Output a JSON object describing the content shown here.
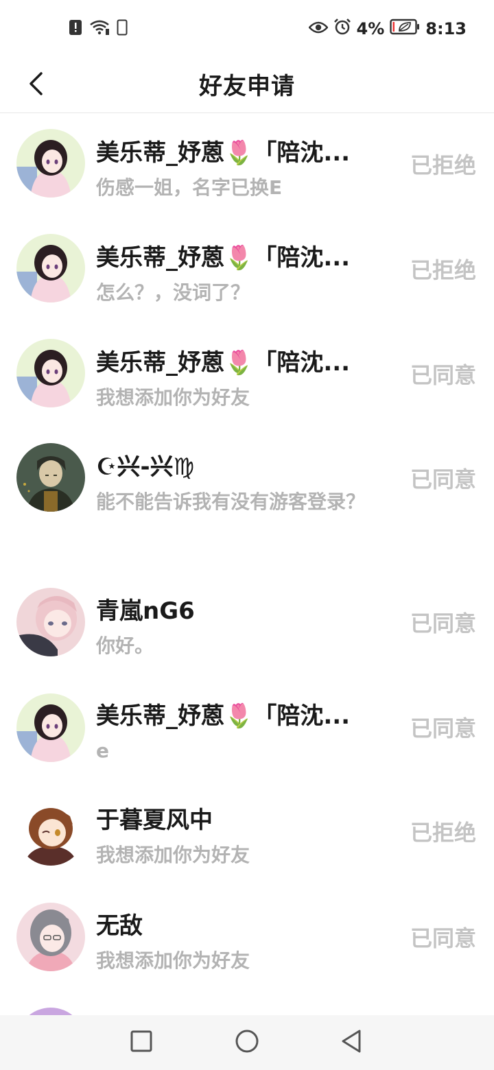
{
  "status_bar": {
    "battery_percent": "4%",
    "time": "8:13",
    "icons": [
      "alert-icon",
      "wifi-icon",
      "sim-icon",
      "eye-icon",
      "alarm-icon",
      "battery-icon"
    ]
  },
  "header": {
    "title": "好友申请",
    "back_icon": "chevron-left-icon"
  },
  "requests": [
    {
      "name": "美乐蒂_妤蒽🌷「陪沈...",
      "message": "伤感一姐，名字已换E",
      "status": "已拒绝",
      "avatar": "anime-girl-dark-hair"
    },
    {
      "name": "美乐蒂_妤蒽🌷「陪沈...",
      "message": "怎么？，没词了？",
      "status": "已拒绝",
      "avatar": "anime-girl-dark-hair"
    },
    {
      "name": "美乐蒂_妤蒽🌷「陪沈...",
      "message": "我想添加你为好友",
      "status": "已同意",
      "avatar": "anime-girl-dark-hair"
    },
    {
      "name": "☪兴-兴♍",
      "message": "能不能告诉我有没有游客登录？",
      "status": "已同意",
      "avatar": "anime-man-uniform"
    },
    {
      "name": "青嵐nG6",
      "message": "你好。",
      "status": "已同意",
      "avatar": "anime-girl-pink-hair"
    },
    {
      "name": "美乐蒂_妤蒽🌷「陪沈...",
      "message": "e",
      "status": "已同意",
      "avatar": "anime-girl-dark-hair"
    },
    {
      "name": "于暮夏风中",
      "message": "我想添加你为好友",
      "status": "已拒绝",
      "avatar": "anime-girl-brown-hair-wink"
    },
    {
      "name": "无敌",
      "message": "我想添加你为好友",
      "status": "已同意",
      "avatar": "anime-girl-grey-hair-glasses"
    }
  ],
  "nav_bar": {
    "icons": [
      "recent-apps-icon",
      "home-icon",
      "back-triangle-icon"
    ]
  }
}
